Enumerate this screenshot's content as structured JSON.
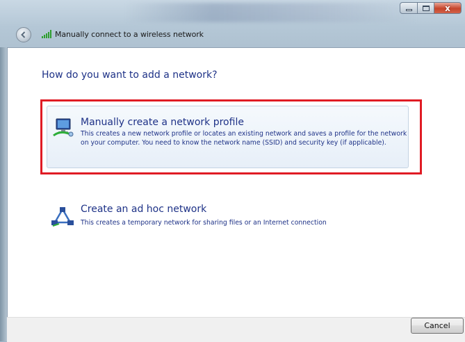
{
  "window": {
    "title": "Manually connect to a wireless network",
    "controls": {
      "close_label": "x"
    }
  },
  "main": {
    "heading": "How do you want to add a network?",
    "options": [
      {
        "title": "Manually create a network profile",
        "description": "This creates a new network profile or locates an existing network and saves a profile for the network on your computer. You need to know the network name (SSID) and security key (if applicable).",
        "icon": "network-computer-icon",
        "highlighted": true
      },
      {
        "title": "Create an ad hoc network",
        "description": "This creates a temporary network for sharing files or an Internet connection",
        "icon": "adhoc-network-icon",
        "highlighted": false
      }
    ]
  },
  "footer": {
    "cancel_label": "Cancel"
  },
  "colors": {
    "link_text": "#1e3287",
    "highlight_box": "#e01b24",
    "close_button": "#c6452b"
  }
}
